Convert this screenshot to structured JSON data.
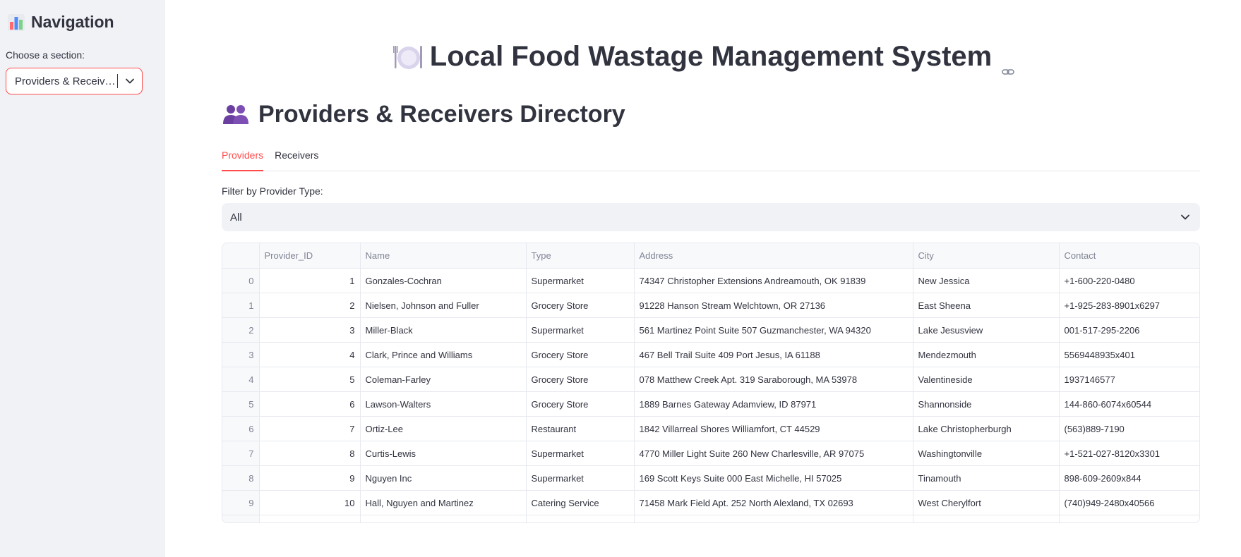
{
  "sidebar": {
    "title": "Navigation",
    "choose_label": "Choose a section:",
    "select_value": "Providers & Receivers"
  },
  "main": {
    "app_title": "Local Food Wastage Management System",
    "section_heading": "Providers & Receivers Directory",
    "tabs": [
      {
        "label": "Providers",
        "active": true
      },
      {
        "label": "Receivers",
        "active": false
      }
    ],
    "filter_label": "Filter by Provider Type:",
    "filter_value": "All"
  },
  "table": {
    "columns": [
      "",
      "Provider_ID",
      "Name",
      "Type",
      "Address",
      "City",
      "Contact"
    ],
    "rows": [
      [
        "0",
        "1",
        "Gonzales-Cochran",
        "Supermarket",
        "74347 Christopher Extensions Andreamouth, OK 91839",
        "New Jessica",
        "+1-600-220-0480"
      ],
      [
        "1",
        "2",
        "Nielsen, Johnson and Fuller",
        "Grocery Store",
        "91228 Hanson Stream Welchtown, OR 27136",
        "East Sheena",
        "+1-925-283-8901x6297"
      ],
      [
        "2",
        "3",
        "Miller-Black",
        "Supermarket",
        "561 Martinez Point Suite 507 Guzmanchester, WA 94320",
        "Lake Jesusview",
        "001-517-295-2206"
      ],
      [
        "3",
        "4",
        "Clark, Prince and Williams",
        "Grocery Store",
        "467 Bell Trail Suite 409 Port Jesus, IA 61188",
        "Mendezmouth",
        "5569448935x401"
      ],
      [
        "4",
        "5",
        "Coleman-Farley",
        "Grocery Store",
        "078 Matthew Creek Apt. 319 Saraborough, MA 53978",
        "Valentineside",
        "1937146577"
      ],
      [
        "5",
        "6",
        "Lawson-Walters",
        "Grocery Store",
        "1889 Barnes Gateway Adamview, ID 87971",
        "Shannonside",
        "144-860-6074x60544"
      ],
      [
        "6",
        "7",
        "Ortiz-Lee",
        "Restaurant",
        "1842 Villarreal Shores Williamfort, CT 44529",
        "Lake Christopherburgh",
        "(563)889-7190"
      ],
      [
        "7",
        "8",
        "Curtis-Lewis",
        "Supermarket",
        "4770 Miller Light Suite 260 New Charlesville, AR 97075",
        "Washingtonville",
        "+1-521-027-8120x3301"
      ],
      [
        "8",
        "9",
        "Nguyen Inc",
        "Supermarket",
        "169 Scott Keys Suite 000 East Michelle, HI 57025",
        "Tinamouth",
        "898-609-2609x844"
      ],
      [
        "9",
        "10",
        "Hall, Nguyen and Martinez",
        "Catering Service",
        "71458 Mark Field Apt. 252 North Alexland, TX 02693",
        "West Cherylfort",
        "(740)949-2480x40566"
      ]
    ]
  },
  "icons": {
    "nav": "bar-chart-icon",
    "title": "fork-knife-plate-icon",
    "heading": "people-icon",
    "anchor": "link-icon",
    "dropdown": "chevron-down-icon"
  },
  "colors": {
    "accent": "#ff4b4b",
    "sidebar_bg": "#f0f2f6",
    "text": "#31333f",
    "muted": "#808495"
  }
}
